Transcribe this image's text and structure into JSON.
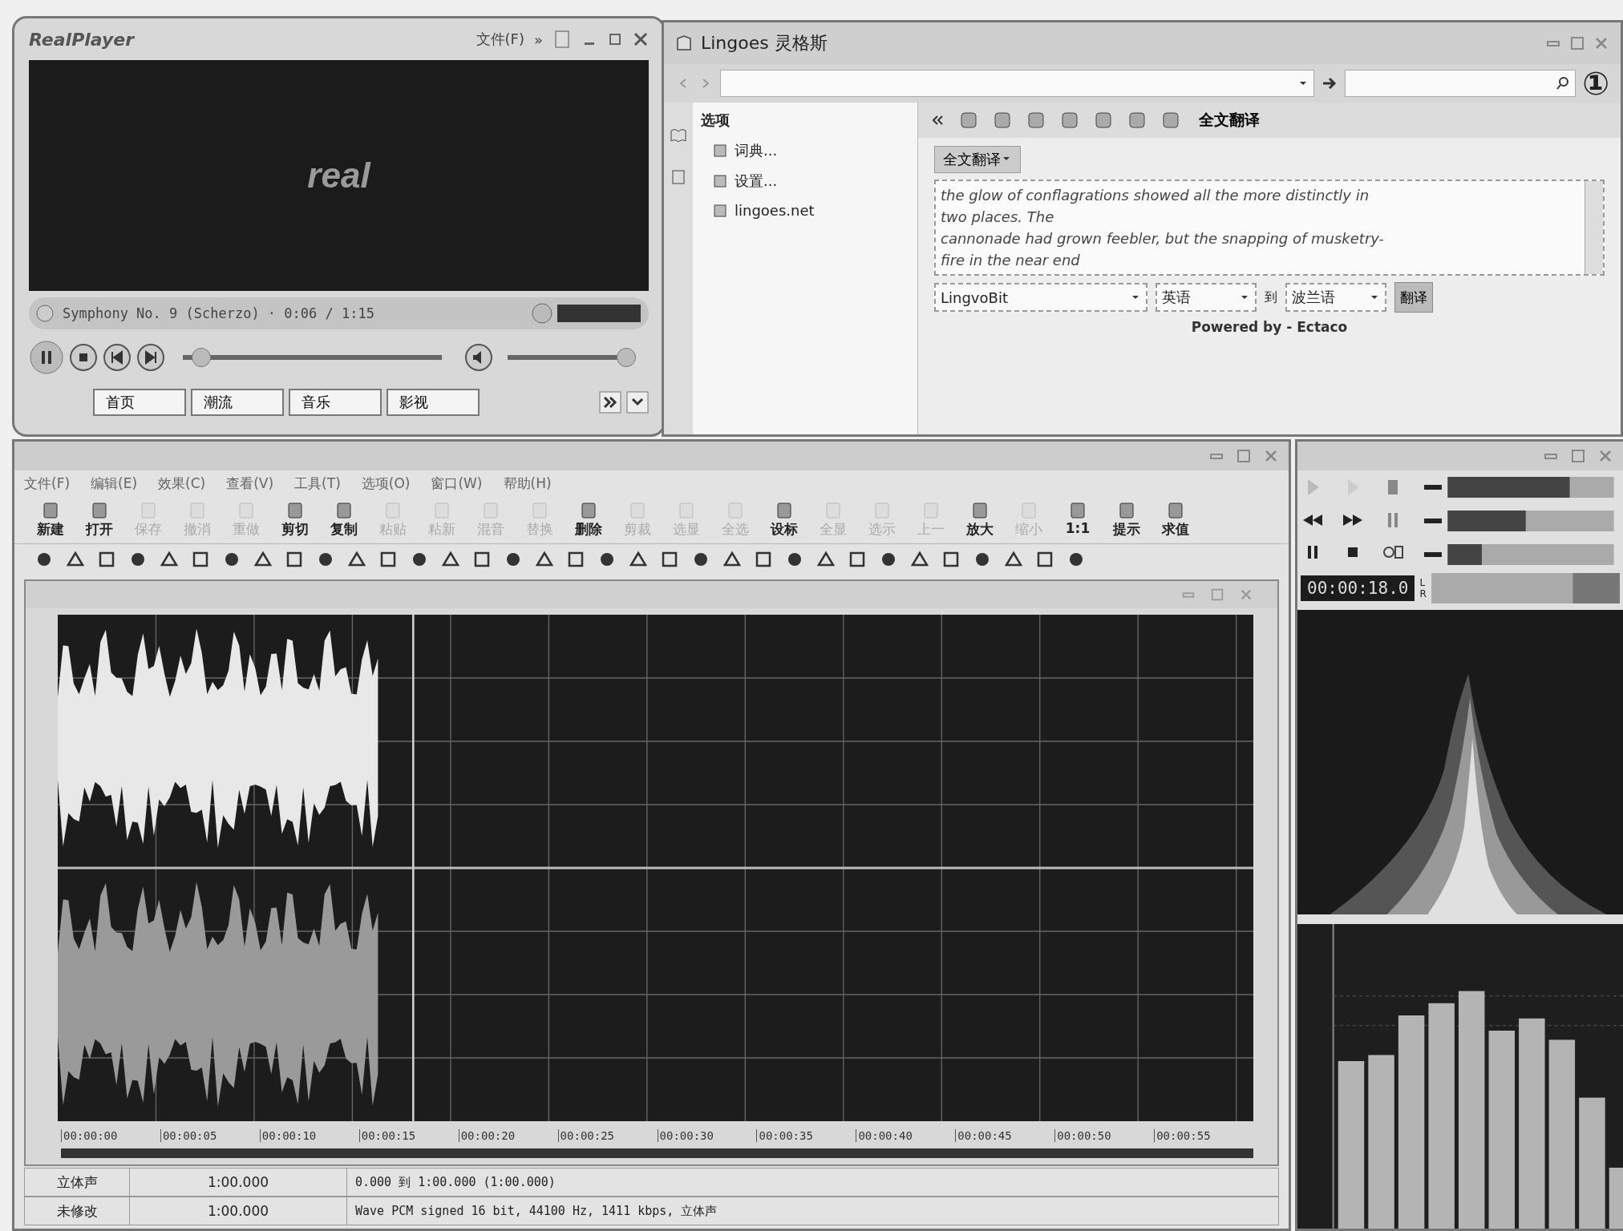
{
  "realplayer": {
    "logo": "RealPlayer",
    "menu": "文件(F)",
    "more": "»",
    "video_logo": "real",
    "track": "Symphony No. 9 (Scherzo) · 0:06 / 1:15",
    "seek": {
      "level": 0.07
    },
    "volume": {
      "level": 0.95
    },
    "nav": [
      "首页",
      "潮流",
      "音乐",
      "影视"
    ]
  },
  "lingoes": {
    "title": "Lingoes 灵格斯",
    "figure_label": "①",
    "sidebar_title": "选项",
    "sidebar_items": [
      "词典...",
      "设置...",
      "lingoes.net"
    ],
    "toolbar_button": "全文翻译",
    "panel_button": "全文翻译",
    "source_text": [
      "the glow of conflagrations showed all the more distinctly in",
      "two places. The",
      "cannonade had grown feebler, but the snapping of musketry-",
      "fire in the near end"
    ],
    "engine": "LingvoBit",
    "from": "英语",
    "to_word": "到",
    "to": "波兰语",
    "translate": "翻译",
    "powered": "Powered by - Ectaco"
  },
  "goldwave": {
    "menus": [
      "文件(F)",
      "编辑(E)",
      "效果(C)",
      "查看(V)",
      "工具(T)",
      "选项(O)",
      "窗口(W)",
      "帮助(H)"
    ],
    "tools": [
      {
        "label": "新建",
        "disabled": false
      },
      {
        "label": "打开",
        "disabled": false
      },
      {
        "label": "保存",
        "disabled": true
      },
      {
        "label": "撤消",
        "disabled": true
      },
      {
        "label": "重做",
        "disabled": true
      },
      {
        "label": "剪切",
        "disabled": false
      },
      {
        "label": "复制",
        "disabled": false
      },
      {
        "label": "粘贴",
        "disabled": true
      },
      {
        "label": "粘新",
        "disabled": true
      },
      {
        "label": "混音",
        "disabled": true
      },
      {
        "label": "替换",
        "disabled": true
      },
      {
        "label": "删除",
        "disabled": false
      },
      {
        "label": "剪裁",
        "disabled": true
      },
      {
        "label": "选显",
        "disabled": true
      },
      {
        "label": "全选",
        "disabled": true
      },
      {
        "label": "设标",
        "disabled": false
      },
      {
        "label": "全显",
        "disabled": true
      },
      {
        "label": "选示",
        "disabled": true
      },
      {
        "label": "上一",
        "disabled": true
      },
      {
        "label": "放大",
        "disabled": false
      },
      {
        "label": "缩小",
        "disabled": true
      },
      {
        "label": "1:1",
        "disabled": false
      },
      {
        "label": "提示",
        "disabled": false
      },
      {
        "label": "求值",
        "disabled": false
      }
    ],
    "ticks": [
      "00:00:00",
      "00:00:05",
      "00:00:10",
      "00:00:15",
      "00:00:20",
      "00:00:25",
      "00:00:30",
      "00:00:35",
      "00:00:40",
      "00:00:45",
      "00:00:50",
      "00:00:55"
    ],
    "status": [
      [
        "立体声",
        "1:00.000",
        "0.000 到 1:00.000 (1:00.000)"
      ],
      [
        "未修改",
        "1:00.000",
        "Wave PCM signed 16 bit, 44100 Hz, 1411 kbps, 立体声"
      ]
    ]
  },
  "controls": {
    "time": "00:00:18.0",
    "channels": [
      "L",
      "R"
    ]
  }
}
